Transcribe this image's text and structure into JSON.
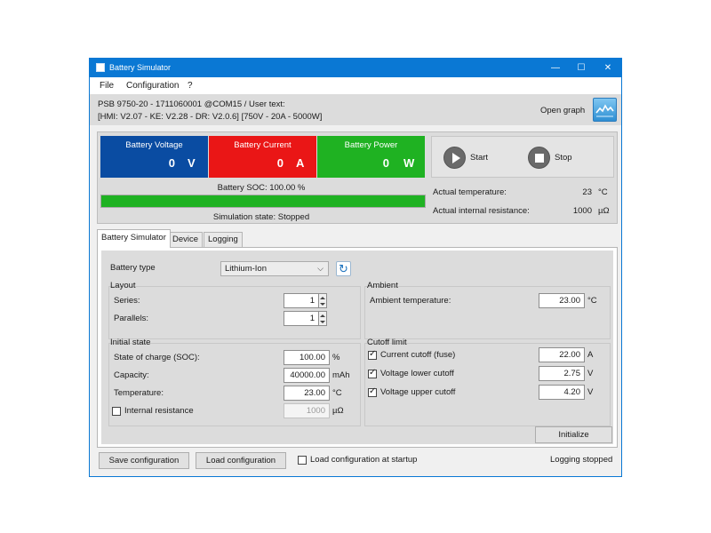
{
  "window": {
    "title": "Battery Simulator",
    "minimize": "—",
    "maximize": "☐",
    "close": "✕"
  },
  "menu": {
    "file": "File",
    "configuration": "Configuration",
    "help": "?"
  },
  "device": {
    "line1": "PSB 9750-20 - 1711060001 @COM15 / User text:",
    "line2": "[HMI: V2.07 - KE: V2.28 - DR: V2.0.6] [750V - 20A - 5000W]",
    "open_graph": "Open graph"
  },
  "meters": {
    "voltage": {
      "label": "Battery Voltage",
      "value": "0",
      "unit": "V",
      "color": "#0a4ca2"
    },
    "current": {
      "label": "Battery Current",
      "value": "0",
      "unit": "A",
      "color": "#ea1616"
    },
    "power": {
      "label": "Battery Power",
      "value": "0",
      "unit": "W",
      "color": "#1fb222"
    }
  },
  "soc": {
    "label": "Battery SOC: 100.00 %",
    "percent": 100
  },
  "simulation_state": "Simulation state: Stopped",
  "controls": {
    "start": "Start",
    "stop": "Stop"
  },
  "status": {
    "temp_label": "Actual temperature:",
    "temp_value": "23",
    "temp_unit": "°C",
    "res_label": "Actual internal resistance:",
    "res_value": "1000",
    "res_unit": "µΩ"
  },
  "tabs": [
    "Battery Simulator",
    "Device",
    "Logging"
  ],
  "battery_type": {
    "label": "Battery type",
    "selected": "Lithium-Ion"
  },
  "layout": {
    "title": "Layout",
    "series_label": "Series:",
    "series_value": "1",
    "parallels_label": "Parallels:",
    "parallels_value": "1"
  },
  "ambient": {
    "title": "Ambient",
    "temp_label": "Ambient temperature:",
    "temp_value": "23.00",
    "temp_unit": "°C"
  },
  "initial": {
    "title": "Initial state",
    "soc_label": "State of charge (SOC):",
    "soc_value": "100.00",
    "soc_unit": "%",
    "capacity_label": "Capacity:",
    "capacity_value": "40000.00",
    "capacity_unit": "mAh",
    "temp_label": "Temperature:",
    "temp_value": "23.00",
    "temp_unit": "°C",
    "ir_label": "Internal resistance",
    "ir_value": "1000",
    "ir_unit": "µΩ",
    "ir_checked": false
  },
  "cutoff": {
    "title": "Cutoff limit",
    "current_label": "Current cutoff (fuse)",
    "current_value": "22.00",
    "current_unit": "A",
    "vlow_label": "Voltage lower cutoff",
    "vlow_value": "2.75",
    "vlow_unit": "V",
    "vhigh_label": "Voltage upper cutoff",
    "vhigh_value": "4.20",
    "vhigh_unit": "V"
  },
  "initialize": "Initialize",
  "bottom": {
    "save": "Save configuration",
    "load": "Load configuration",
    "load_startup": "Load configuration at startup",
    "logging_status": "Logging stopped"
  },
  "icons": {
    "check": "✓",
    "refresh": "↻",
    "chevron": "⌵"
  }
}
